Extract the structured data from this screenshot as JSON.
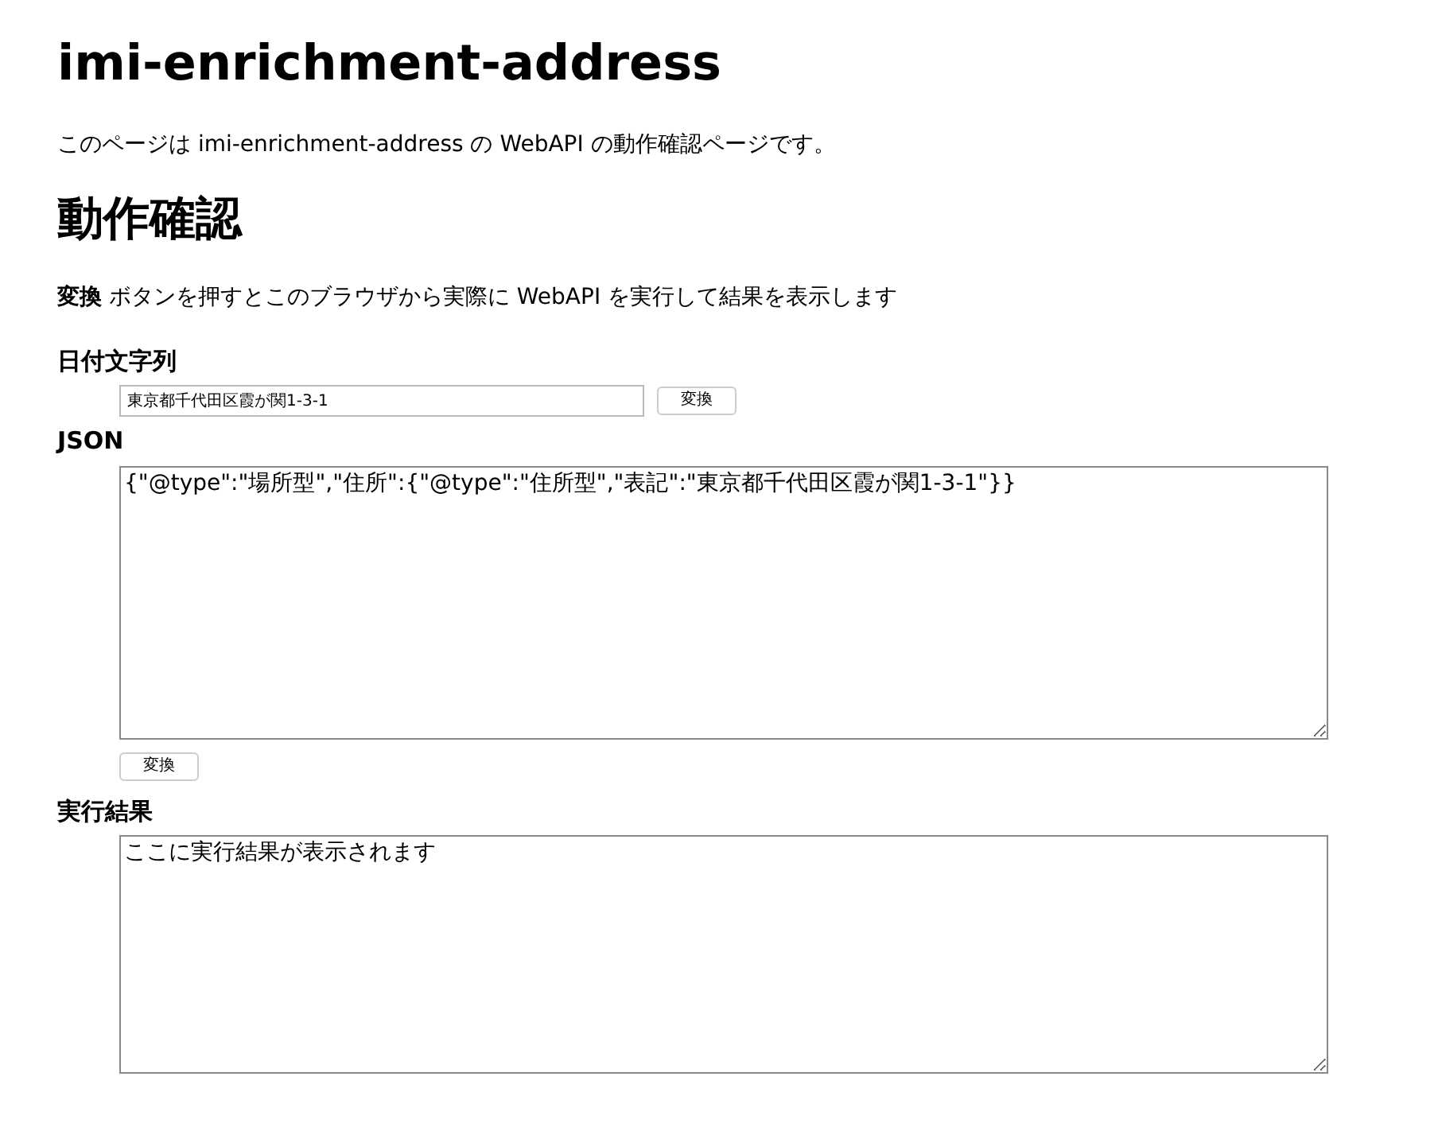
{
  "title": "imi-enrichment-address",
  "intro": "このページは imi-enrichment-address の WebAPI の動作確認ページです。",
  "section_heading": "動作確認",
  "instruction": "**変換** ボタンを押すとこのブラウザから実際に WebAPI を実行して結果を表示します",
  "date_string": {
    "label": "日付文字列",
    "value": "東京都千代田区霞が関1-3-1",
    "button": "変換"
  },
  "json": {
    "label": "JSON",
    "value": "{\"@type\":\"場所型\",\"住所\":{\"@type\":\"住所型\",\"表記\":\"東京都千代田区霞が関1-3-1\"}}",
    "button": "変換"
  },
  "result": {
    "label": "実行結果",
    "value": "ここに実行結果が表示されます"
  }
}
